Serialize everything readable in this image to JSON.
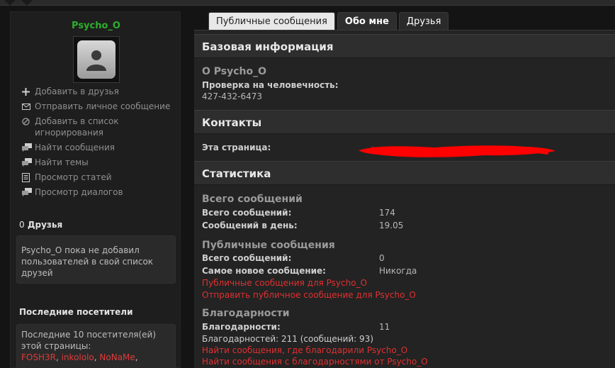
{
  "sidebar": {
    "username": "Psycho_O",
    "actions": [
      {
        "icon": "plus-icon",
        "label": "Добавить в друзья"
      },
      {
        "icon": "envelope-icon",
        "label": "Отправить личное сообщение"
      },
      {
        "icon": "block-icon",
        "label": "Добавить в список игнорирования"
      },
      {
        "icon": "chat-icon",
        "label": "Найти сообщения"
      },
      {
        "icon": "chat-icon",
        "label": "Найти темы"
      },
      {
        "icon": "document-icon",
        "label": "Просмотр статей"
      },
      {
        "icon": "chat-icon",
        "label": "Просмотр диалогов"
      }
    ],
    "friends": {
      "count": "0",
      "title": "Друзья",
      "empty_text": "Psycho_O пока не добавил пользователей в свой список друзей"
    },
    "visitors": {
      "title": "Последние посетители",
      "intro": "Последние 10 посетителя(ей) этой страницы:",
      "names": [
        "FOSH3R",
        "inkololo",
        "NoNaMe"
      ]
    }
  },
  "tabs": [
    "Публичные сообщения",
    "Обо мне",
    "Друзья"
  ],
  "basic": {
    "header": "Базовая информация",
    "about_title": "О Psycho_O",
    "humanity_label": "Проверка на человечность:",
    "humanity_value": "427-432-6473"
  },
  "contacts": {
    "header": "Контакты",
    "page_label": "Эта страница:"
  },
  "stats": {
    "header": "Статистика",
    "total": {
      "title": "Всего сообщений",
      "rows": [
        {
          "label": "Всего сообщений:",
          "value": "174"
        },
        {
          "label": "Сообщений в день:",
          "value": "19.05"
        }
      ]
    },
    "public": {
      "title": "Публичные сообщения",
      "rows": [
        {
          "label": "Всего сообщений:",
          "value": "0"
        },
        {
          "label": "Самое новое сообщение:",
          "value": "Никогда"
        }
      ],
      "links": [
        "Публичные сообщения для Psycho_O",
        "Отправить публичное сообщение для Psycho_O"
      ]
    },
    "thanks": {
      "title": "Благодарности",
      "label": "Благодарности:",
      "value": "11",
      "detail": "Благодарностей: 211 (сообщений: 93)",
      "links": [
        "Найти сообщения, где благодарили Psycho_O",
        "Найти сообщения с благодарностями от Psycho_O"
      ]
    }
  },
  "colors": {
    "username": "#2bb02b",
    "link": "#e03030",
    "redaction": "#ff0000"
  }
}
